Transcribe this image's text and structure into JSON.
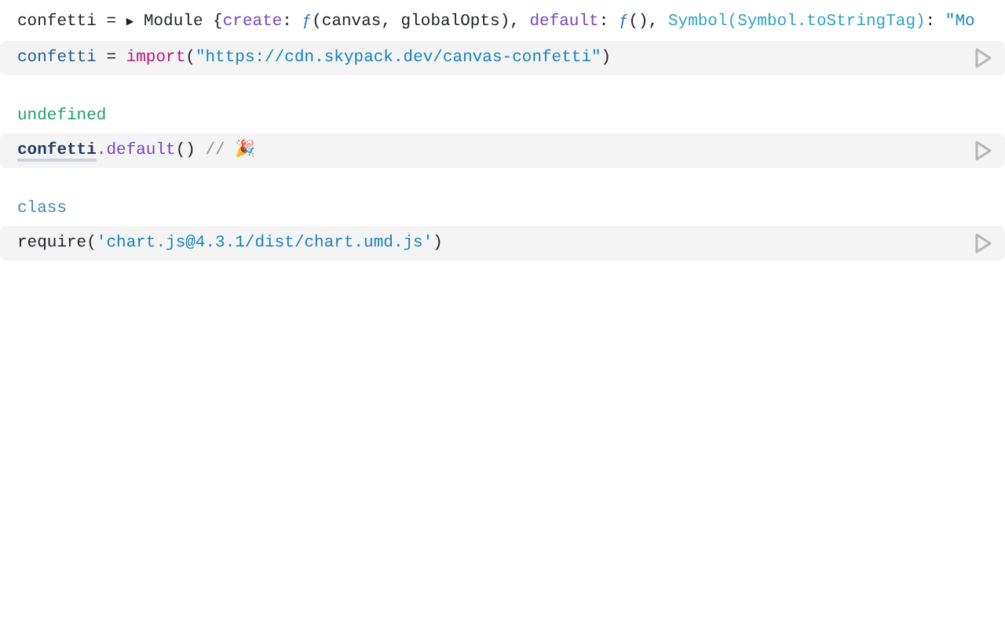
{
  "cells": [
    {
      "output": [
        {
          "text": "confetti = ",
          "kind": "plain"
        },
        {
          "text": "▶",
          "kind": "toggle"
        },
        {
          "text": " Module {",
          "kind": "plain"
        },
        {
          "text": "create",
          "kind": "property"
        },
        {
          "text": ": ",
          "kind": "plain"
        },
        {
          "text": "ƒ",
          "kind": "fn"
        },
        {
          "text": "(canvas, globalOpts), ",
          "kind": "plain"
        },
        {
          "text": "default",
          "kind": "property"
        },
        {
          "text": ": ",
          "kind": "plain"
        },
        {
          "text": "ƒ",
          "kind": "fn"
        },
        {
          "text": "(), ",
          "kind": "plain"
        },
        {
          "text": "Symbol(Symbol.toStringTag)",
          "kind": "symbol"
        },
        {
          "text": ": ",
          "kind": "plain"
        },
        {
          "text": "\"Mo",
          "kind": "string"
        }
      ],
      "code": [
        {
          "text": "confetti",
          "kind": "variable"
        },
        {
          "text": " = ",
          "kind": "plain"
        },
        {
          "text": "import",
          "kind": "keyword"
        },
        {
          "text": "(",
          "kind": "plain"
        },
        {
          "text": "\"https://cdn.skypack.dev/canvas-confetti\"",
          "kind": "string"
        },
        {
          "text": ")",
          "kind": "plain"
        }
      ]
    },
    {
      "output": [
        {
          "text": "undefined",
          "kind": "undefined"
        }
      ],
      "code": [
        {
          "text": "confetti",
          "kind": "reference"
        },
        {
          "text": ".default",
          "kind": "property"
        },
        {
          "text": "() ",
          "kind": "plain"
        },
        {
          "text": "// ",
          "kind": "comment"
        },
        {
          "text": "🎉",
          "kind": "comment"
        }
      ]
    },
    {
      "output": [
        {
          "text": "class",
          "kind": "classname"
        }
      ],
      "code": [
        {
          "text": "require",
          "kind": "plain"
        },
        {
          "text": "(",
          "kind": "plain"
        },
        {
          "text": "'chart.js@4.3.1/dist/chart.umd.js'",
          "kind": "string"
        },
        {
          "text": ")",
          "kind": "plain"
        }
      ]
    }
  ]
}
